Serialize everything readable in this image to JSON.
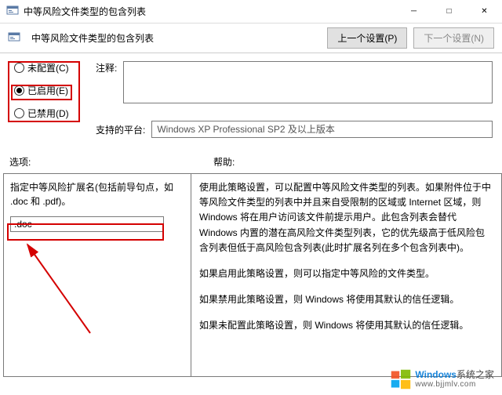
{
  "window": {
    "title": "中等风险文件类型的包含列表"
  },
  "subheader": {
    "title": "中等风险文件类型的包含列表",
    "prev_btn": "上一个设置(P)",
    "next_btn": "下一个设置(N)"
  },
  "radios": {
    "not_configured": "未配置(C)",
    "enabled": "已启用(E)",
    "disabled": "已禁用(D)"
  },
  "labels": {
    "comment": "注释:",
    "platform": "支持的平台:",
    "options": "选项:",
    "help": "帮助:"
  },
  "platform_text": "Windows XP Professional SP2 及以上版本",
  "options_pane": {
    "instruction": "指定中等风险扩展名(包括前导句点，如 .doc 和 .pdf)。",
    "input_value": ".doc"
  },
  "help_text": {
    "p1": "使用此策略设置，可以配置中等风险文件类型的列表。如果附件位于中等风险文件类型的列表中并且来自受限制的区域或 Internet 区域，则 Windows 将在用户访问该文件前提示用户。此包含列表会替代 Windows 内置的潜在高风险文件类型列表，它的优先级高于低风险包含列表但低于高风险包含列表(此时扩展名列在多个包含列表中)。",
    "p2": "如果启用此策略设置，则可以指定中等风险的文件类型。",
    "p3": "如果禁用此策略设置，则 Windows 将使用其默认的信任逻辑。",
    "p4": "如果未配置此策略设置，则 Windows 将使用其默认的信任逻辑。"
  },
  "watermark": {
    "brand": "Windows系统之家",
    "url": "www.bjjmlv.com"
  }
}
